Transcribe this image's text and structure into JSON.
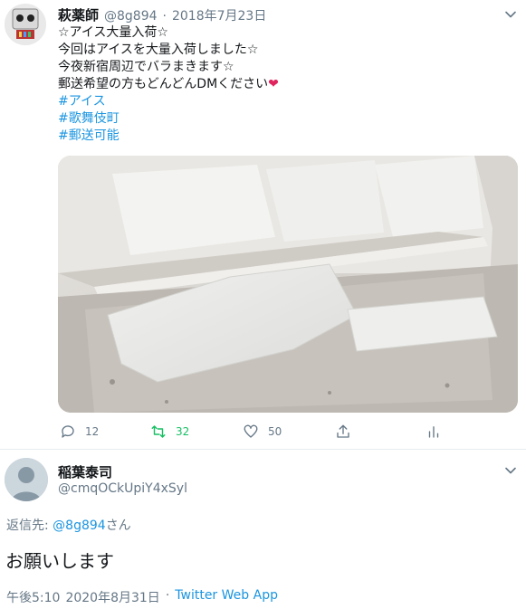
{
  "tweet": {
    "display_name": "萩薬師",
    "handle": "@8g894",
    "separator": "·",
    "date": "2018年7月23日",
    "lines": [
      "☆アイス大量入荷☆",
      "今回はアイスを大量入荷しました☆",
      "今夜新宿周辺でバラまきます☆",
      "郵送希望の方もどんどんDMください"
    ],
    "hashtags": [
      "#アイス",
      "#歌舞伎町",
      "#郵送可能"
    ],
    "heart_emoji": "❤",
    "actions": {
      "reply_count": "12",
      "retweet_count": "32",
      "like_count": "50"
    },
    "accent_color": "#1b95e0",
    "retweet_color": "#17bf63"
  },
  "reply": {
    "display_name": "稲葉泰司",
    "handle": "@cmqOCkUpiY4xSyl",
    "replying_to_prefix": "返信先:",
    "replying_to_handle": "@8g894",
    "replying_to_suffix": "さん",
    "text": "お願いします",
    "time": "午後5:10",
    "separator": "·",
    "date": "2020年8月31日",
    "source": "Twitter Web App"
  }
}
